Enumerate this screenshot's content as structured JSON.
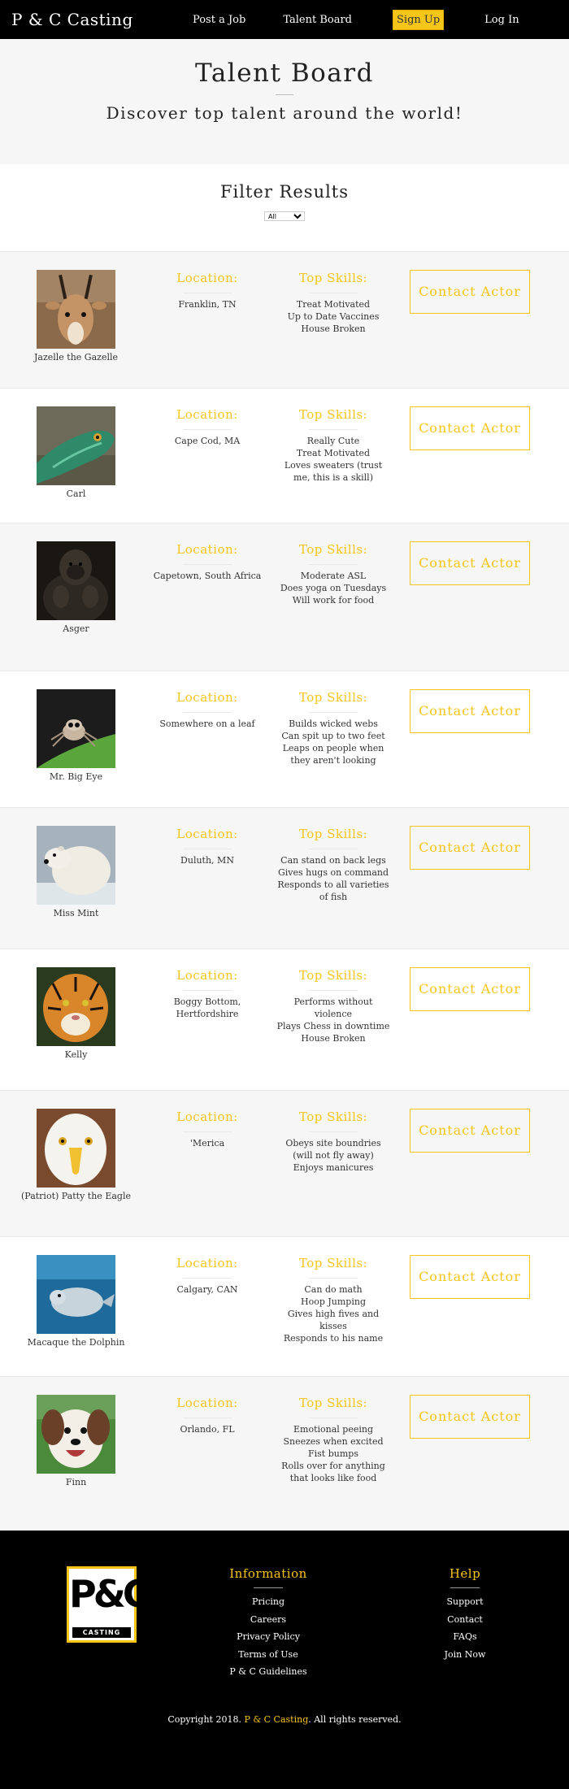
{
  "nav": {
    "brand": "P & C Casting",
    "links": {
      "post_job": "Post a Job",
      "talent_board": "Talent Board",
      "sign_up": "Sign Up",
      "log_in": "Log In"
    }
  },
  "hero": {
    "title": "Talent Board",
    "tagline": "Discover top talent around the world!"
  },
  "filter": {
    "title": "Filter Results",
    "selected": "All",
    "options": [
      "All"
    ]
  },
  "labels": {
    "location": "Location:",
    "skills": "Top Skills:",
    "contact": "Contact Actor"
  },
  "talents": [
    {
      "name": "Jazelle the Gazelle",
      "location": "Franklin, TN",
      "skills": [
        "Treat Motivated",
        "Up to Date Vaccines",
        "House Broken"
      ]
    },
    {
      "name": "Carl",
      "location": "Cape Cod, MA",
      "skills": [
        "Really Cute",
        "Treat Motivated",
        "Loves sweaters (trust me, this is a skill)"
      ]
    },
    {
      "name": "Asger",
      "location": "Capetown, South Africa",
      "skills": [
        "Moderate ASL",
        "Does yoga on Tuesdays",
        "Will work for food"
      ]
    },
    {
      "name": "Mr. Big Eye",
      "location": "Somewhere on a leaf",
      "skills": [
        "Builds wicked webs",
        "Can spit up to two feet",
        "Leaps on people when they aren't looking"
      ]
    },
    {
      "name": "Miss Mint",
      "location": "Duluth, MN",
      "skills": [
        "Can stand on back legs",
        "Gives hugs on command",
        "Responds to all varieties of fish"
      ]
    },
    {
      "name": "Kelly",
      "location": "Boggy Bottom, Hertfordshire",
      "skills": [
        "Performs without violence",
        "Plays Chess in downtime",
        "House Broken"
      ]
    },
    {
      "name": "(Patriot) Patty the Eagle",
      "location": "'Merica",
      "skills": [
        "Obeys site boundries (will not fly away)",
        "Enjoys manicures"
      ]
    },
    {
      "name": "Macaque the Dolphin",
      "location": "Calgary, CAN",
      "skills": [
        "Can do math",
        "Hoop Jumping",
        "Gives high fives and kisses",
        "Responds to his name"
      ]
    },
    {
      "name": "Finn",
      "location": "Orlando, FL",
      "skills": [
        "Emotional peeing",
        "Sneezes when excited",
        "Fist bumps",
        "Rolls over for anything that looks like food"
      ]
    }
  ],
  "footer": {
    "logo": {
      "mark": "P&C",
      "text": "CASTING"
    },
    "information": {
      "title": "Information",
      "links": [
        "Pricing",
        "Careers",
        "Privacy Policy",
        "Terms of Use",
        "P & C Guidelines"
      ]
    },
    "help": {
      "title": "Help",
      "links": [
        "Support",
        "Contact",
        "FAQs",
        "Join Now"
      ]
    },
    "copyright": {
      "prefix": "Copyright 2018.",
      "brand": "P & C Casting",
      "suffix": ". All rights reserved."
    }
  }
}
